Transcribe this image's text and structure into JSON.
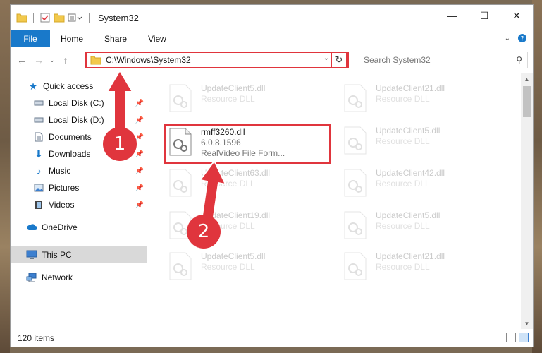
{
  "window": {
    "title": "System32"
  },
  "ribbon": {
    "tabs": [
      "File",
      "Home",
      "Share",
      "View"
    ]
  },
  "address": {
    "path": "C:\\Windows\\System32"
  },
  "search": {
    "placeholder": "Search System32"
  },
  "navpane": {
    "items": [
      {
        "label": "Quick access",
        "icon": "star-icon",
        "pinned": false
      },
      {
        "label": "Local Disk (C:)",
        "icon": "drive-icon",
        "pinned": true
      },
      {
        "label": "Local Disk (D:)",
        "icon": "drive-icon",
        "pinned": true
      },
      {
        "label": "Documents",
        "icon": "documents-icon",
        "pinned": true
      },
      {
        "label": "Downloads",
        "icon": "download-icon",
        "pinned": true
      },
      {
        "label": "Music",
        "icon": "music-icon",
        "pinned": true
      },
      {
        "label": "Pictures",
        "icon": "pictures-icon",
        "pinned": true
      },
      {
        "label": "Videos",
        "icon": "videos-icon",
        "pinned": true
      },
      {
        "label": "OneDrive",
        "icon": "cloud-icon",
        "pinned": false
      },
      {
        "label": "This PC",
        "icon": "computer-icon",
        "pinned": false,
        "selected": true
      },
      {
        "label": "Network",
        "icon": "network-icon",
        "pinned": false
      }
    ]
  },
  "files": [
    {
      "name": "UpdateClient5.dll",
      "sub": "Resource DLL",
      "faded": true
    },
    {
      "name": "UpdateClient21.dll",
      "sub": "Resource DLL",
      "faded": true
    },
    {
      "name": "rmff3260.dll",
      "sub": "6.0.8.1596",
      "sub2": "RealVideo File Form...",
      "faded": false,
      "highlighted": true
    },
    {
      "name": "UpdateClient5.dll",
      "sub": "Resource DLL",
      "faded": true
    },
    {
      "name": "UpdateClient63.dll",
      "sub": "Resource DLL",
      "faded": true
    },
    {
      "name": "UpdateClient42.dll",
      "sub": "Resource DLL",
      "faded": true
    },
    {
      "name": "UpdateClient19.dll",
      "sub": "Resource DLL",
      "faded": true
    },
    {
      "name": "UpdateClient5.dll",
      "sub": "Resource DLL",
      "faded": true
    },
    {
      "name": "UpdateClient5.dll",
      "sub": "Resource DLL",
      "faded": true
    },
    {
      "name": "UpdateClient21.dll",
      "sub": "Resource DLL",
      "faded": true
    }
  ],
  "status": {
    "item_count": "120 items"
  },
  "callouts": {
    "one": "1",
    "two": "2"
  },
  "colors": {
    "accent": "#1979ca",
    "callout": "#e0353d"
  }
}
